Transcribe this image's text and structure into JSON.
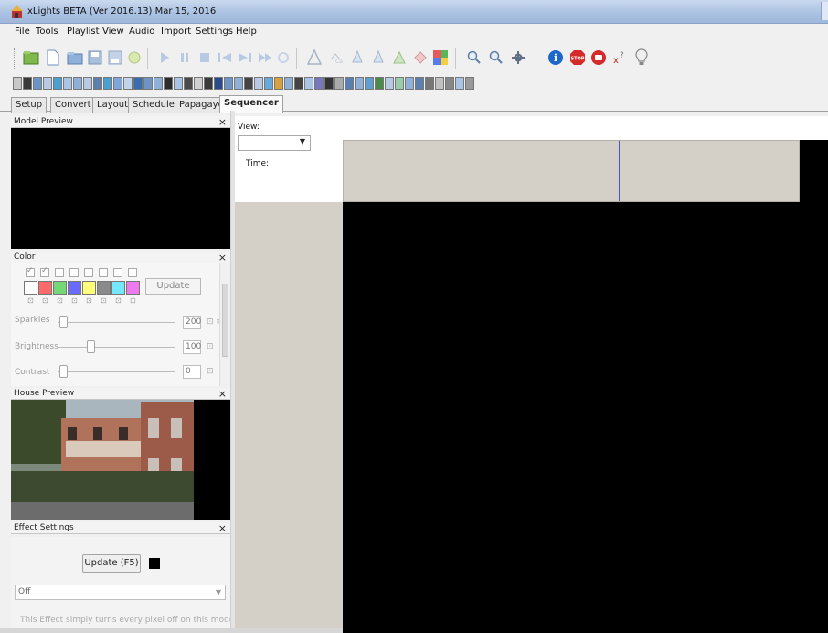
{
  "window": {
    "title": "xLights BETA (Ver 2016.13) Mar 15, 2016"
  },
  "menu": [
    "File",
    "Tools",
    "Playlist",
    "View",
    "Audio",
    "Import",
    "Settings",
    "Help"
  ],
  "toolbar": {
    "icons": [
      "open-folder-icon",
      "new-file-icon",
      "open-icon",
      "save-icon",
      "save-as-icon",
      "render-icon",
      "play-icon",
      "pause-icon",
      "stop-icon",
      "first-frame-icon",
      "last-frame-icon",
      "replay-icon",
      "bucket-pine-icon",
      "paint-bucket-icon",
      "bucket-a-icon",
      "bucket-b-icon",
      "bucket-c-icon",
      "bucket-d-icon",
      "color-grid-icon",
      "zoom-in-icon",
      "zoom-out-icon",
      "gear-icon",
      "info-icon",
      "stop-sign-icon",
      "red-circle-icon",
      "help-key-icon",
      "bulb-icon"
    ]
  },
  "tabs": [
    "Setup",
    "Convert",
    "Layout",
    "Schedule",
    "Papagayo",
    "Sequencer"
  ],
  "active_tab": "Sequencer",
  "panels": {
    "model_preview": {
      "title": "Model Preview",
      "close": "×"
    },
    "color": {
      "title": "Color",
      "close": "×",
      "update_label": "Update",
      "palette": [
        "#ffffff",
        "#ff6a6a",
        "#74d874",
        "#6a6aff",
        "#ffff7a",
        "#8a8a8a",
        "#74e8ff",
        "#ee7af0"
      ],
      "checked": [
        true,
        true,
        false,
        false,
        false,
        false,
        false,
        false
      ],
      "sliders": [
        {
          "label": "Sparkles",
          "value": "200"
        },
        {
          "label": "Brightness",
          "value": "100"
        },
        {
          "label": "Contrast",
          "value": "0"
        }
      ]
    },
    "house_preview": {
      "title": "House Preview",
      "close": "×"
    },
    "effect_settings": {
      "title": "Effect Settings",
      "close": "×",
      "update_label": "Update (F5)",
      "selected_effect": "Off",
      "description": "This Effect simply turns every pixel off on this model."
    }
  },
  "sequencer": {
    "view_label": "View:",
    "time_label": "Time:"
  },
  "colors": {
    "title_bar": "#a9c1e2",
    "grid": "#000000",
    "timeline": "#d4d0c8",
    "cursor": "#4858b8"
  }
}
